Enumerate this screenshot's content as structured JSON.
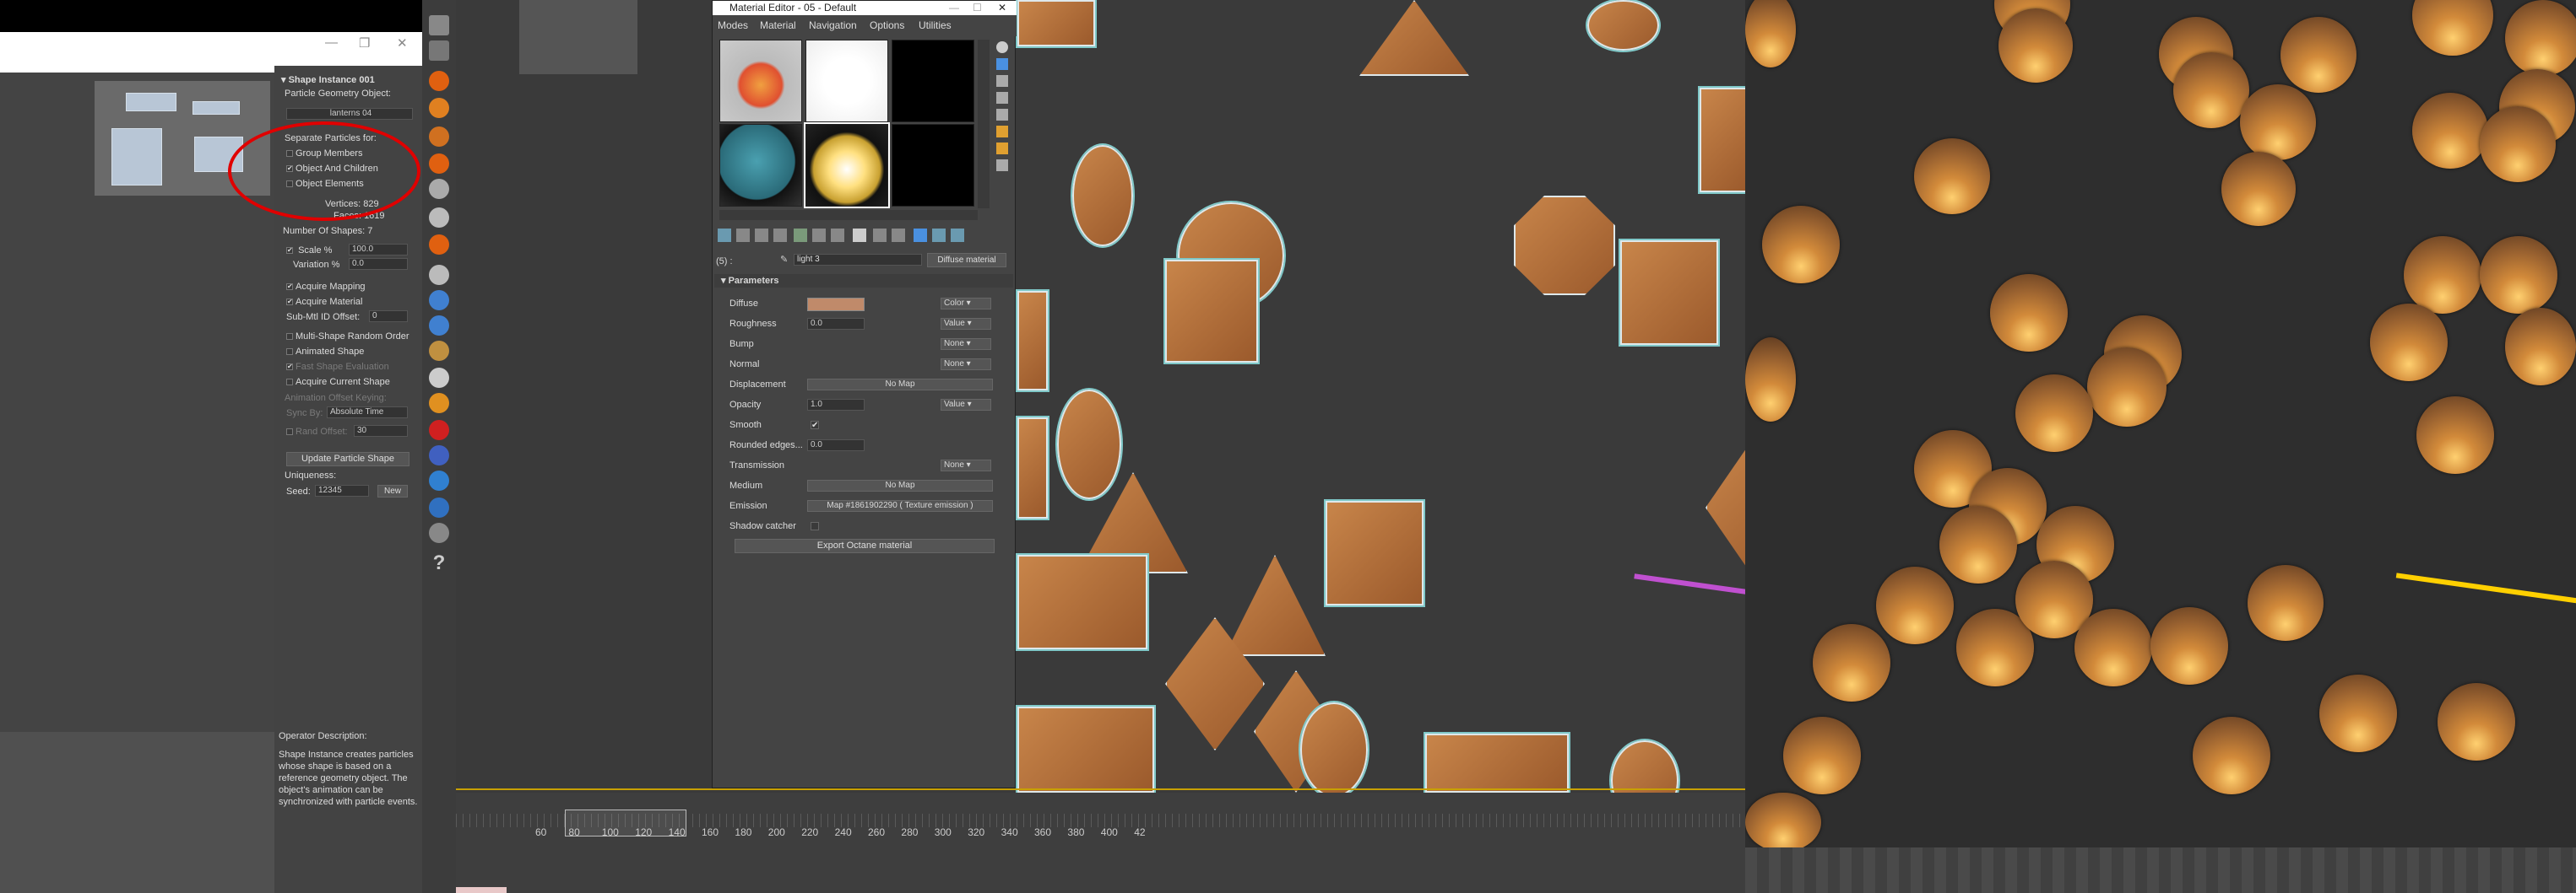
{
  "left": {
    "window_buttons": [
      "—",
      "❐",
      "✕"
    ],
    "shape_panel": {
      "title": "Shape Instance 001",
      "geom_label": "Particle Geometry Object:",
      "geom_value": "lanterns 04",
      "separate_label": "Separate Particles for:",
      "opt_group": "Group Members",
      "opt_object_children": "Object And Children",
      "opt_elements": "Object Elements",
      "vertices": "Vertices: 829",
      "faces": "Faces: 1619",
      "num_shapes": "Number Of Shapes: 7",
      "scale_label": "Scale %",
      "scale_value": "100.0",
      "variation_label": "Variation %",
      "variation_value": "0.0",
      "acquire_mapping": "Acquire Mapping",
      "acquire_material": "Acquire Material",
      "submtl_label": "Sub-Mtl ID Offset:",
      "submtl_value": "0",
      "multi_shape": "Multi-Shape Random Order",
      "animated_shape": "Animated Shape",
      "fast_shape": "Fast Shape Evaluation",
      "acquire_current": "Acquire Current Shape",
      "anim_offset": "Animation Offset Keying:",
      "sync_label": "Sync By:",
      "sync_value": "Absolute Time",
      "rand_label": "Rand Offset:",
      "rand_value": "30",
      "update_btn": "Update Particle Shape",
      "uniqueness": "Uniqueness:",
      "seed_label": "Seed:",
      "seed_value": "12345",
      "new_btn": "New"
    },
    "operator_desc_title": "Operator Description:",
    "operator_desc": "Shape Instance creates particles whose shape is based on a reference geometry object. The object's animation can be synchronized with particle events."
  },
  "material_editor": {
    "title": "Material Editor - 05 - Default",
    "menu": [
      "Modes",
      "Material",
      "Navigation",
      "Options",
      "Utilities"
    ],
    "slot_label": "(5) :",
    "mat_name": "light 3",
    "mat_type": "Diffuse material",
    "params_title": "Parameters",
    "rows": [
      {
        "label": "Diffuse",
        "dd": "Color"
      },
      {
        "label": "Roughness",
        "val": "0.0",
        "dd": "Value"
      },
      {
        "label": "Bump",
        "dd": "None"
      },
      {
        "label": "Normal",
        "dd": "None"
      },
      {
        "label": "Displacement",
        "wide": "No Map"
      },
      {
        "label": "Opacity",
        "val": "1.0",
        "dd": "Value"
      },
      {
        "label": "Smooth",
        "check": "✔"
      },
      {
        "label": "Rounded edges...",
        "val": "0.0"
      },
      {
        "label": "Transmission",
        "dd": "None"
      },
      {
        "label": "Medium",
        "wide": "No Map"
      },
      {
        "label": "Emission",
        "wide": "Map #1861902290 ( Texture emission )"
      },
      {
        "label": "Shadow catcher"
      }
    ],
    "export_btn": "Export Octane material",
    "diffuse_color": "#c08a6a"
  },
  "timeline": {
    "ticks": [
      "60",
      "80",
      "100",
      "120",
      "140",
      "160",
      "180",
      "200",
      "220",
      "240",
      "260",
      "280",
      "300",
      "320",
      "340",
      "360",
      "380",
      "400",
      "42"
    ]
  },
  "colors": {
    "accent_red": "#e00000",
    "wood": "#b87040",
    "outline": "#7fc8c8"
  }
}
